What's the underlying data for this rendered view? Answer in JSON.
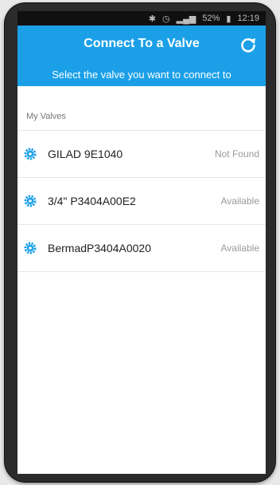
{
  "status_bar": {
    "battery": "52%",
    "time": "12:19"
  },
  "header": {
    "title": "Connect To a Valve",
    "subtitle": "Select the valve you want to connect to",
    "refresh_icon": "refresh-icon"
  },
  "list": {
    "section_label": "My Valves",
    "items": [
      {
        "name": "GILAD 9E1040",
        "status": "Not Found",
        "icon": "gear-icon"
      },
      {
        "name": "3/4\" P3404A00E2",
        "status": "Available",
        "icon": "gear-icon"
      },
      {
        "name": "BermadP3404A0020",
        "status": "Available",
        "icon": "gear-icon"
      }
    ]
  },
  "colors": {
    "accent": "#1BA0E8",
    "status_text": "#9A9A9A"
  }
}
